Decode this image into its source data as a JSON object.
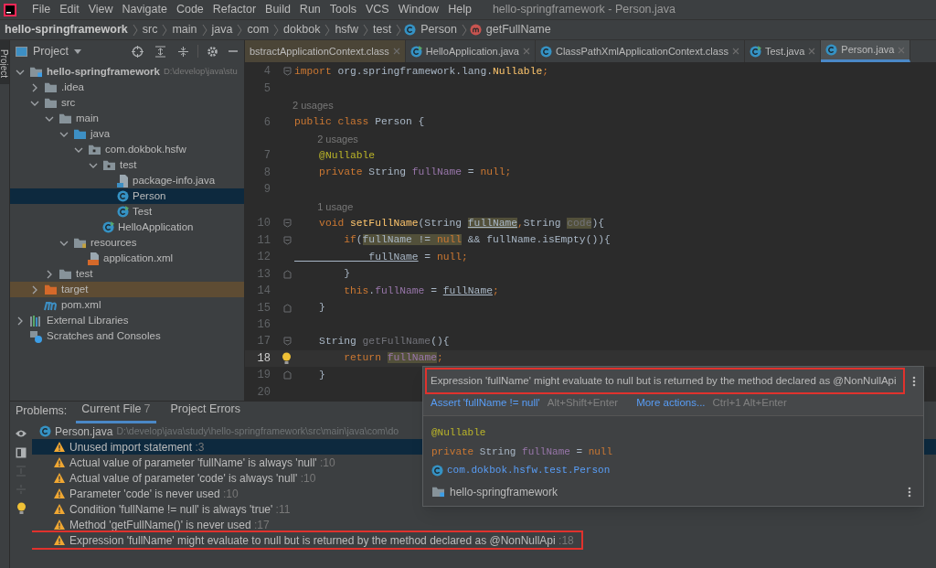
{
  "menu": [
    "File",
    "Edit",
    "View",
    "Navigate",
    "Code",
    "Refactor",
    "Build",
    "Run",
    "Tools",
    "VCS",
    "Window",
    "Help"
  ],
  "window": {
    "title": "hello-springframework - Person.java"
  },
  "breadcrumb": [
    {
      "label": "hello-springframework"
    },
    {
      "label": "src"
    },
    {
      "label": "main"
    },
    {
      "label": "java"
    },
    {
      "label": "com"
    },
    {
      "label": "dokbok"
    },
    {
      "label": "hsfw"
    },
    {
      "label": "test"
    },
    {
      "label": "Person",
      "kind": "class"
    },
    {
      "label": "getFullName",
      "kind": "method"
    }
  ],
  "side_stripe": {
    "label": "Project"
  },
  "project_panel": {
    "title": "Project"
  },
  "tree": [
    {
      "label": "hello-springframework",
      "path": "D:\\develop\\java\\stu",
      "kind": "module",
      "expanded": true,
      "selected": false,
      "children": [
        {
          "label": ".idea",
          "kind": "folder",
          "expanded": false,
          "selected": false
        },
        {
          "label": "src",
          "kind": "folder",
          "expanded": true,
          "selected": false,
          "children": [
            {
              "label": "main",
              "kind": "folder",
              "expanded": true,
              "selected": false,
              "children": [
                {
                  "label": "java",
                  "kind": "source",
                  "expanded": true,
                  "selected": false,
                  "children": [
                    {
                      "label": "com.dokbok.hsfw",
                      "kind": "package",
                      "expanded": true,
                      "selected": false,
                      "children": [
                        {
                          "label": "test",
                          "kind": "package",
                          "expanded": true,
                          "selected": false,
                          "children": [
                            {
                              "label": "package-info.java",
                              "kind": "file",
                              "selected": false
                            },
                            {
                              "label": "Person",
                              "kind": "class",
                              "selected": true
                            },
                            {
                              "label": "Test",
                              "kind": "runclass",
                              "selected": false
                            }
                          ]
                        },
                        {
                          "label": "HelloApplication",
                          "kind": "runclass",
                          "selected": false
                        }
                      ]
                    }
                  ]
                },
                {
                  "label": "resources",
                  "kind": "resources",
                  "expanded": true,
                  "selected": false,
                  "children": [
                    {
                      "label": "application.xml",
                      "kind": "xml",
                      "selected": false
                    }
                  ]
                }
              ]
            },
            {
              "label": "test",
              "kind": "folder",
              "expanded": false,
              "selected": false
            }
          ]
        },
        {
          "label": "target",
          "kind": "target",
          "expanded": false,
          "selected": false,
          "excluded": true
        },
        {
          "label": "pom.xml",
          "kind": "maven",
          "selected": false
        }
      ]
    },
    {
      "label": "External Libraries",
      "kind": "libraries",
      "expanded": false,
      "selected": false
    },
    {
      "label": "Scratches and Consoles",
      "kind": "scratches",
      "selected": false
    }
  ],
  "editor_tabs": [
    {
      "label": "bstractApplicationContext.class",
      "selected": false
    },
    {
      "label": "HelloApplication.java",
      "kind": "runclass",
      "selected": false
    },
    {
      "label": "ClassPathXmlApplicationContext.class",
      "kind": "class",
      "selected": false
    },
    {
      "label": "Test.java",
      "kind": "runclass",
      "selected": false
    },
    {
      "label": "Person.java",
      "kind": "class",
      "selected": true
    }
  ],
  "code": [
    {
      "kind": "code",
      "number": "4",
      "fold_start": true,
      "current": false,
      "tokens": [
        {
          "text": "import ",
          "kind": "kw"
        },
        {
          "text": "org.springframework.lang.",
          "kind": "plain"
        },
        {
          "text": "Nullable",
          "kind": "fn"
        },
        {
          "text": ";",
          "kind": "kw"
        }
      ]
    },
    {
      "kind": "code",
      "number": "5",
      "current": false
    },
    {
      "kind": "hint",
      "text": "2 usages"
    },
    {
      "kind": "code",
      "number": "6",
      "current": false,
      "tokens": [
        {
          "text": "public class ",
          "kind": "kw"
        },
        {
          "text": "Person {",
          "kind": "plain"
        }
      ]
    },
    {
      "kind": "hint",
      "text": "    2 usages"
    },
    {
      "kind": "code",
      "number": "7",
      "current": false,
      "tokens": [
        {
          "text": "    @Nullable",
          "kind": "ann"
        }
      ]
    },
    {
      "kind": "code",
      "number": "8",
      "current": false,
      "tokens": [
        {
          "text": "    private ",
          "kind": "kw"
        },
        {
          "text": "String ",
          "kind": "plain"
        },
        {
          "text": "fullName",
          "kind": "field"
        },
        {
          "text": " = ",
          "kind": "plain"
        },
        {
          "text": "null;",
          "kind": "kw"
        }
      ]
    },
    {
      "kind": "code",
      "number": "9",
      "current": false
    },
    {
      "kind": "hint",
      "text": "    1 usage"
    },
    {
      "kind": "code",
      "number": "10",
      "fold_start": true,
      "current": false,
      "tokens": [
        {
          "text": "    void ",
          "kind": "kw"
        },
        {
          "text": "setFullName",
          "kind": "fn"
        },
        {
          "text": "(String ",
          "kind": "plain"
        },
        {
          "text": "fullName",
          "kind": "plain",
          "highlighted": true,
          "underlined": true
        },
        {
          "text": ",",
          "kind": "kw"
        },
        {
          "text": "String ",
          "kind": "plain"
        },
        {
          "text": "code",
          "kind": "grey",
          "highlighted": true
        },
        {
          "text": "){",
          "kind": "plain"
        }
      ]
    },
    {
      "kind": "code",
      "number": "11",
      "fold_start": true,
      "current": false,
      "tokens": [
        {
          "text": "        if",
          "kind": "kw"
        },
        {
          "text": "(",
          "kind": "plain"
        },
        {
          "text": "fullName != ",
          "kind": "plain",
          "highlighted": true
        },
        {
          "text": "null",
          "kind": "kw",
          "highlighted": true
        },
        {
          "text": " && fullName.isEmpty()){",
          "kind": "plain"
        }
      ]
    },
    {
      "kind": "code",
      "number": "12",
      "current": false,
      "tokens": [
        {
          "text": "            fullName",
          "kind": "plain",
          "underlined": true
        },
        {
          "text": " = ",
          "kind": "plain"
        },
        {
          "text": "null;",
          "kind": "kw"
        }
      ]
    },
    {
      "kind": "code",
      "number": "13",
      "fold_end": true,
      "current": false,
      "tokens": [
        {
          "text": "        }",
          "kind": "plain"
        }
      ]
    },
    {
      "kind": "code",
      "number": "14",
      "current": false,
      "tokens": [
        {
          "text": "        this",
          "kind": "kw"
        },
        {
          "text": ".",
          "kind": "plain"
        },
        {
          "text": "fullName",
          "kind": "field"
        },
        {
          "text": " = ",
          "kind": "plain"
        },
        {
          "text": "fullName",
          "kind": "plain",
          "underlined": true
        },
        {
          "text": ";",
          "kind": "kw"
        }
      ]
    },
    {
      "kind": "code",
      "number": "15",
      "fold_end": true,
      "current": false,
      "tokens": [
        {
          "text": "    }",
          "kind": "plain"
        }
      ]
    },
    {
      "kind": "code",
      "number": "16",
      "current": false
    },
    {
      "kind": "code",
      "number": "17",
      "fold_start": true,
      "current": false,
      "tokens": [
        {
          "text": "    String ",
          "kind": "plain"
        },
        {
          "text": "getFullName",
          "kind": "grey"
        },
        {
          "text": "(){",
          "kind": "plain"
        }
      ]
    },
    {
      "kind": "code",
      "number": "18",
      "current": true,
      "bulb": true,
      "tokens": [
        {
          "text": "        return ",
          "kind": "kw"
        },
        {
          "text": "fullName",
          "kind": "field",
          "highlighted": true
        },
        {
          "text": ";",
          "kind": "kw"
        }
      ]
    },
    {
      "kind": "code",
      "number": "19",
      "fold_end": true,
      "current": false,
      "tokens": [
        {
          "text": "    }",
          "kind": "plain"
        }
      ]
    },
    {
      "kind": "code",
      "number": "20",
      "current": false
    }
  ],
  "problems": {
    "label": "Problems:",
    "tabs": [
      {
        "label": "Current File",
        "count": "7",
        "selected": true
      },
      {
        "label": "Project Errors",
        "selected": false
      }
    ],
    "file": {
      "name": "Person.java",
      "path": "D:\\develop\\java\\study\\hello-springframework\\src\\main\\java\\com\\do"
    },
    "items": [
      {
        "text": "Unused import statement",
        "line": ":3",
        "selected": true,
        "highlighted": false
      },
      {
        "text": "Actual value of parameter 'fullName' is always 'null'",
        "line": ":10",
        "selected": false,
        "highlighted": false
      },
      {
        "text": "Actual value of parameter 'code' is always 'null'",
        "line": ":10",
        "selected": false,
        "highlighted": false
      },
      {
        "text": "Parameter 'code' is never used",
        "line": ":10",
        "selected": false,
        "highlighted": false
      },
      {
        "text": "Condition 'fullName != null' is always 'true'",
        "line": ":11",
        "selected": false,
        "highlighted": false
      },
      {
        "text": "Method 'getFullName()' is never used",
        "line": ":17",
        "selected": false,
        "highlighted": false
      },
      {
        "text": "Expression 'fullName' might evaluate to null but is returned by the method declared as @NonNullApi",
        "line": ":18",
        "selected": false,
        "highlighted": true
      }
    ]
  },
  "popup": {
    "message": "Expression 'fullName' might evaluate to null but is returned by the method declared as @NonNullApi",
    "highlighted": true,
    "actions": [
      {
        "label": "Assert 'fullName != null'",
        "shortcut": "Alt+Shift+Enter"
      },
      {
        "label": "More actions...",
        "shortcut": "Ctrl+1 Alt+Enter"
      }
    ],
    "annotation": "@Nullable",
    "declaration": [
      {
        "text": "private ",
        "kind": "kw"
      },
      {
        "text": "String ",
        "kind": "plain"
      },
      {
        "text": "fullName",
        "kind": "field"
      },
      {
        "text": " = ",
        "kind": "plain"
      },
      {
        "text": "null",
        "kind": "kw"
      }
    ],
    "class_name": "com.dokbok.hsfw.test.Person",
    "module": "hello-springframework"
  }
}
